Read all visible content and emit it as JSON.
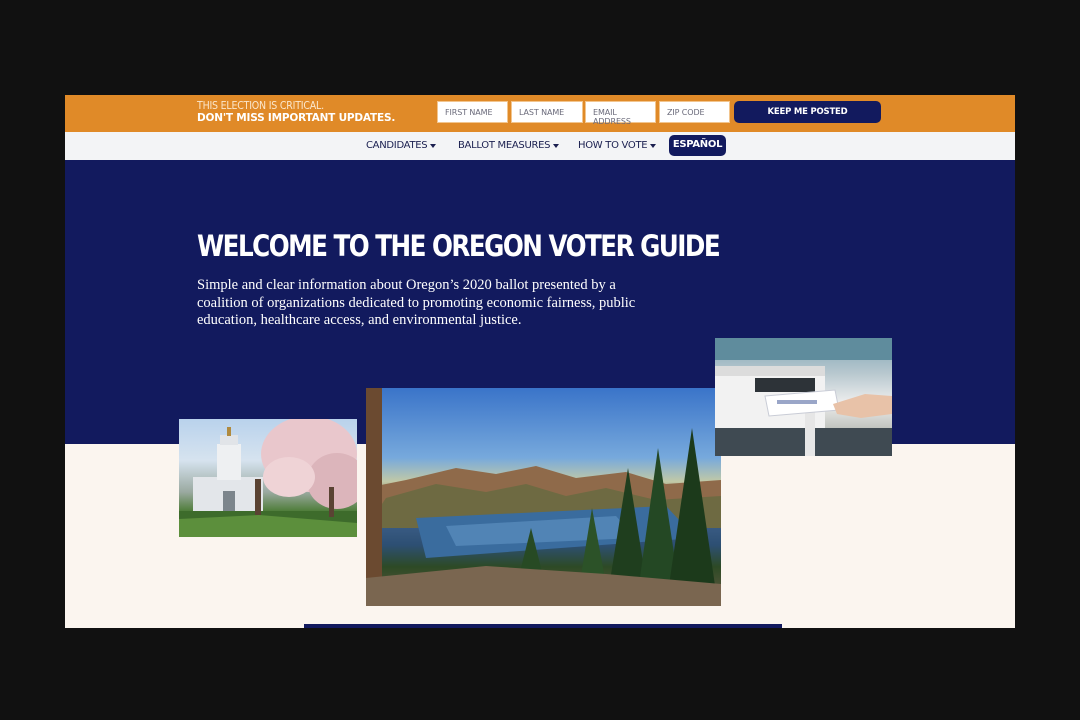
{
  "signup": {
    "line1": "THIS ELECTION IS CRITICAL.",
    "line2": "DON'T MISS IMPORTANT UPDATES.",
    "first_name_placeholder": "FIRST NAME",
    "last_name_placeholder": "LAST NAME",
    "email_placeholder": "EMAIL ADDRESS",
    "zip_placeholder": "ZIP CODE",
    "submit_label": "KEEP ME POSTED"
  },
  "nav": {
    "candidates": "CANDIDATES",
    "ballot_measures": "BALLOT MEASURES",
    "how_to_vote": "HOW TO VOTE",
    "espanol": "ESPAÑOL"
  },
  "hero": {
    "title": "WELCOME TO THE OREGON VOTER GUIDE",
    "description": "Simple and clear information about Oregon’s 2020 ballot presented by a coalition of organizations dedicated to promoting economic fairness, public education, healthcare access, and environmental justice."
  },
  "colors": {
    "orange_bar": "#e08a28",
    "navy": "#121a5e",
    "nav_bg": "#f3f4f6",
    "cream": "#fbf5ef"
  },
  "images": {
    "capitol": "oregon-state-capitol-with-cherry-blossoms",
    "lake": "crater-lake-landscape",
    "mailbox": "hand-dropping-ballot-in-drop-box"
  }
}
